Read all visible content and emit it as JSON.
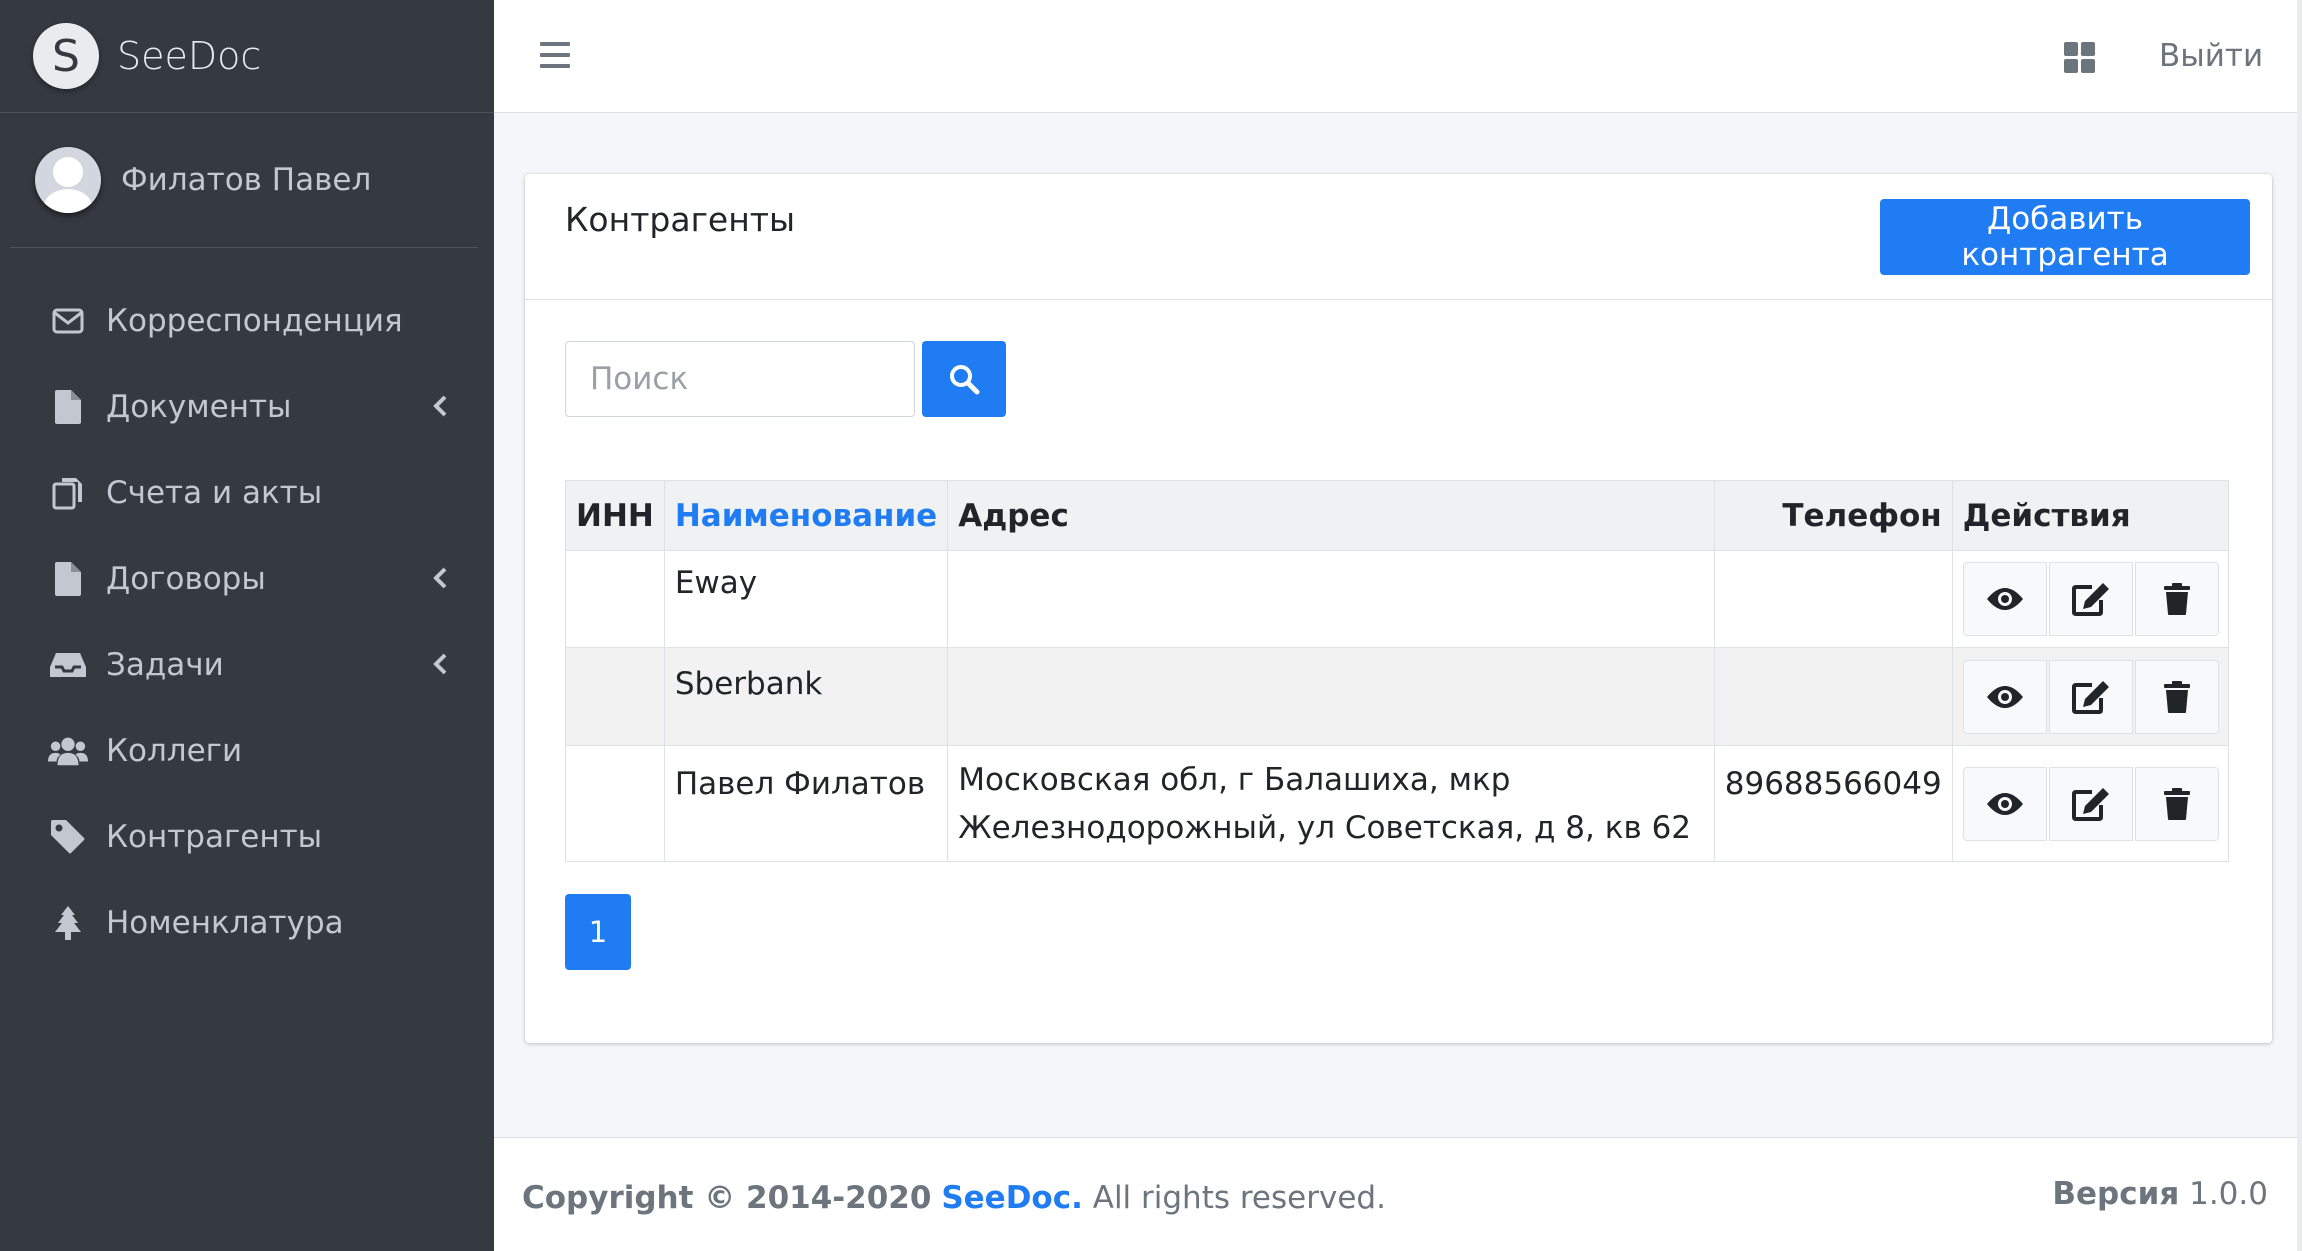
{
  "brand": {
    "logo_letter": "S",
    "name": "SeeDoc"
  },
  "user": {
    "name": "Филатов Павел"
  },
  "sidebar": {
    "items": [
      {
        "label": "Корреспонденция",
        "icon": "envelope-icon",
        "has_submenu": false
      },
      {
        "label": "Документы",
        "icon": "file-icon",
        "has_submenu": true
      },
      {
        "label": "Счета и акты",
        "icon": "copy-icon",
        "has_submenu": false
      },
      {
        "label": "Договоры",
        "icon": "file-icon",
        "has_submenu": true
      },
      {
        "label": "Задачи",
        "icon": "inbox-icon",
        "has_submenu": true
      },
      {
        "label": "Коллеги",
        "icon": "users-icon",
        "has_submenu": false
      },
      {
        "label": "Контрагенты",
        "icon": "tag-icon",
        "has_submenu": false
      },
      {
        "label": "Номенклатура",
        "icon": "tree-icon",
        "has_submenu": false
      }
    ]
  },
  "topbar": {
    "logout_label": "Выйти"
  },
  "card": {
    "title": "Контрагенты",
    "add_button_label": "Добавить контрагента"
  },
  "search": {
    "placeholder": "Поиск",
    "value": ""
  },
  "table": {
    "headers": [
      "ИНН",
      "Наименование",
      "Адрес",
      "Телефон",
      "Действия"
    ],
    "rows": [
      {
        "inn": "",
        "name": "Eway",
        "address": "",
        "phone": ""
      },
      {
        "inn": "",
        "name": "Sberbank",
        "address": "",
        "phone": ""
      },
      {
        "inn": "",
        "name": "Павел Филатов",
        "address": "Московская обл, г Балашиха, мкр Железнодорожный, ул Советская, д 8, кв 62",
        "phone": "89688566049"
      }
    ]
  },
  "pagination": {
    "current_page": "1"
  },
  "footer": {
    "copyright_prefix": "Copyright © 2014-2020",
    "brand_link": "SeeDoc.",
    "rights": "All rights reserved.",
    "version_label": "Версия",
    "version_value": "1.0.0"
  },
  "colors": {
    "sidebar_bg": "#343a40",
    "primary": "#1f7cf2",
    "content_bg": "#f4f6f9"
  }
}
